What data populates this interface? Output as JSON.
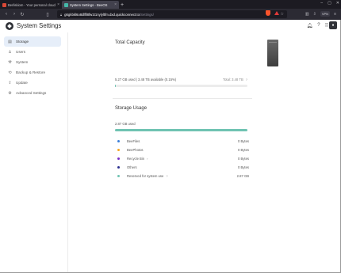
{
  "browser": {
    "tabs": [
      {
        "label": "Berliskiom - Your personal cloud po...",
        "close": "×"
      },
      {
        "label": "System Settings - BeeOS",
        "close": "×"
      }
    ],
    "new_tab": "+",
    "url_host": "g6gkbkl6o8dlfll8fw1t1nylyltfm.dxd.quickconnect.to",
    "url_path": "/Settings/",
    "vpn_label": "VPN",
    "window_controls": [
      "–",
      "▢",
      "✕"
    ]
  },
  "app": {
    "title": "System Settings"
  },
  "sidebar": {
    "items": [
      {
        "label": "Storage",
        "icon": "storage-icon",
        "glyph": "▤",
        "active": true
      },
      {
        "label": "Users",
        "icon": "user-icon",
        "glyph": "♙",
        "active": false
      },
      {
        "label": "System",
        "icon": "wrench-icon",
        "glyph": "⚒",
        "active": false
      },
      {
        "label": "Backup & Restore",
        "icon": "backup-icon",
        "glyph": "⟲",
        "active": false
      },
      {
        "label": "Update",
        "icon": "update-icon",
        "glyph": "⇪",
        "active": false
      },
      {
        "label": "Advanced Settings",
        "icon": "settings-icon",
        "glyph": "⚙",
        "active": false
      }
    ]
  },
  "capacity": {
    "title": "Total Capacity",
    "used_text": "5.27 GB used",
    "available_text": "3.48 TB available (0.15%)",
    "total_text": "Total: 3.48 TB",
    "used_fraction": 0.0015
  },
  "usage": {
    "title": "Storage Usage",
    "used_text": "2.87 GB used",
    "used_fraction": 1.0,
    "accent": "#6fc3b2",
    "rows": [
      {
        "name": "BeeFiles",
        "value": "0 Bytes",
        "color": "#3b7fd9"
      },
      {
        "name": "BeePhotos",
        "value": "0 Bytes",
        "color": "#f5a623"
      },
      {
        "name": "Recycle Bin",
        "value": "0 Bytes",
        "color": "#7b2fc7",
        "chevron": "›"
      },
      {
        "name": "Others",
        "value": "0 Bytes",
        "color": "#2a2f8f"
      },
      {
        "name": "Reserved for system use",
        "value": "2.87 GB",
        "color": "#6fc3b2",
        "help": "?"
      }
    ]
  }
}
